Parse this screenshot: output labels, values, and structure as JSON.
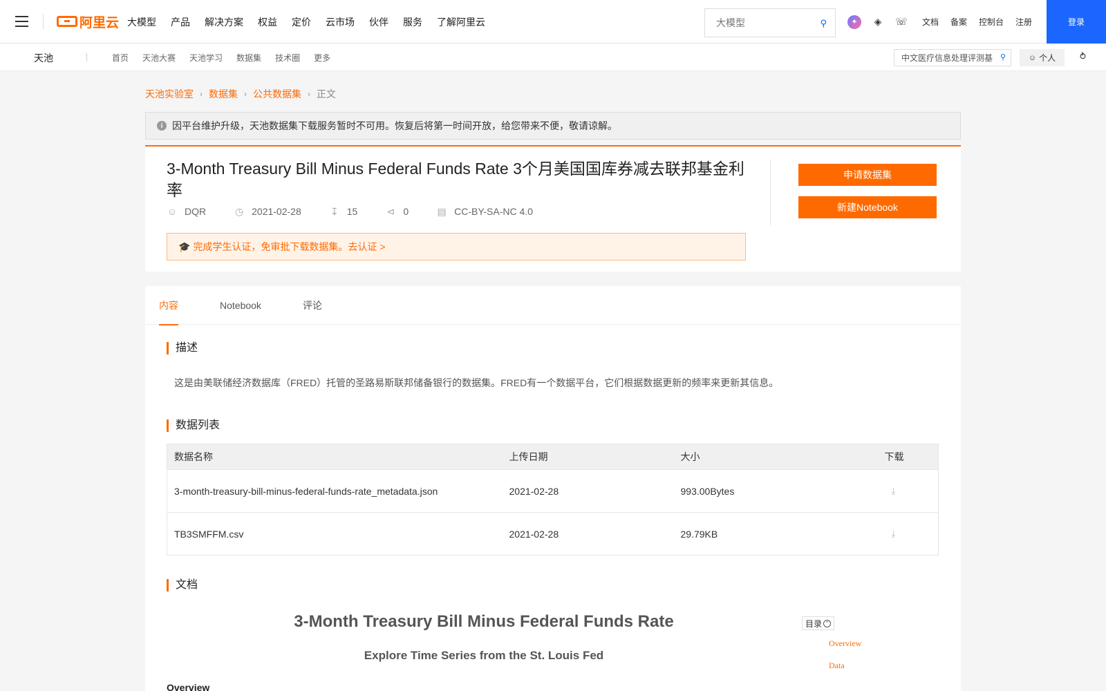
{
  "topnav": {
    "logo_text": "阿里云",
    "menu": [
      "大模型",
      "产品",
      "解决方案",
      "权益",
      "定价",
      "云市场",
      "伙伴",
      "服务",
      "了解阿里云"
    ],
    "search_placeholder": "大模型",
    "links": [
      "文档",
      "备案",
      "控制台",
      "注册"
    ],
    "login_label": "登录"
  },
  "subnav": {
    "brand": "天池",
    "links": [
      "首页",
      "天池大赛",
      "天池学习",
      "数据集",
      "技术圈",
      "更多"
    ],
    "search_value": "中文医疗信息处理评测基",
    "personal_label": "个人"
  },
  "breadcrumb": [
    "天池实验室",
    "数据集",
    "公共数据集",
    "正文"
  ],
  "notice": {
    "text": "因平台维护升级，天池数据集下载服务暂时不可用。恢复后将第一时间开放，给您带来不便，敬请谅解。"
  },
  "dataset": {
    "title": "3-Month Treasury Bill Minus Federal Funds Rate 3个月美国国库券减去联邦基金利率",
    "author": "DQR",
    "date": "2021-02-28",
    "downloads": "15",
    "shares": "0",
    "license": "CC-BY-SA-NC 4.0",
    "student_cert": "完成学生认证，免审批下载数据集。去认证 >",
    "apply_label": "申请数据集",
    "notebook_label": "新建Notebook"
  },
  "tabs": [
    "内容",
    "Notebook",
    "评论"
  ],
  "sections": {
    "description_title": "描述",
    "description_text": "这是由美联储经济数据库（FRED）托管的圣路易斯联邦储备银行的数据集。FRED有一个数据平台，它们根据数据更新的频率来更新其信息。",
    "datalist_title": "数据列表",
    "docs_title": "文档"
  },
  "table": {
    "headers": [
      "数据名称",
      "上传日期",
      "大小",
      "下载"
    ],
    "rows": [
      {
        "name": "3-month-treasury-bill-minus-federal-funds-rate_metadata.json",
        "date": "2021-02-28",
        "size": "993.00Bytes"
      },
      {
        "name": "TB3SMFFM.csv",
        "date": "2021-02-28",
        "size": "29.79KB"
      }
    ]
  },
  "document": {
    "h1": "3-Month Treasury Bill Minus Federal Funds Rate",
    "h2": "Explore Time Series from the St. Louis Fed",
    "h3": "Overview",
    "toc_label": "目录",
    "toc_items": [
      "Overview",
      "Data"
    ]
  },
  "colors": {
    "accent": "#ff6a00",
    "primary": "#1a66ff"
  }
}
